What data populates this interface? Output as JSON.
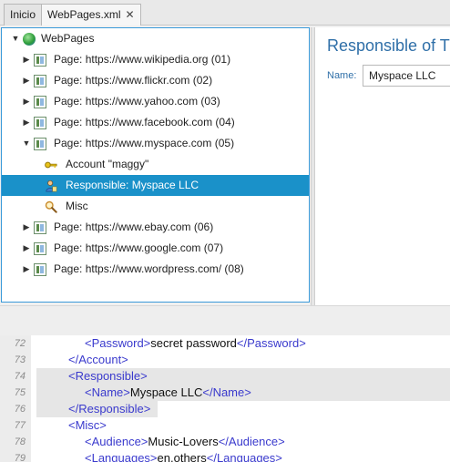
{
  "tabs": [
    {
      "label": "Inicio",
      "active": false
    },
    {
      "label": "WebPages.xml",
      "active": true,
      "close": "✕"
    }
  ],
  "tree": {
    "root": {
      "label": "WebPages",
      "icon": "globe-icon",
      "expanded": true
    },
    "items": [
      {
        "label": "Page: https://www.wikipedia.org (01)",
        "icon": "page-icon",
        "expanded": false
      },
      {
        "label": "Page: https://www.flickr.com (02)",
        "icon": "page-icon",
        "expanded": false
      },
      {
        "label": "Page: https://www.yahoo.com (03)",
        "icon": "page-icon",
        "expanded": false
      },
      {
        "label": "Page: https://www.facebook.com (04)",
        "icon": "page-icon",
        "expanded": false
      },
      {
        "label": "Page: https://www.myspace.com (05)",
        "icon": "page-icon",
        "expanded": true
      },
      {
        "label": "Account \"maggy\"",
        "icon": "key-icon",
        "child": true
      },
      {
        "label": "Responsible: Myspace LLC",
        "icon": "person-icon",
        "child": true,
        "selected": true
      },
      {
        "label": "Misc",
        "icon": "magnifier-icon",
        "child": true
      },
      {
        "label": "Page: https://www.ebay.com (06)",
        "icon": "page-icon",
        "expanded": false
      },
      {
        "label": "Page: https://www.google.com (07)",
        "icon": "page-icon",
        "expanded": false
      },
      {
        "label": "Page: https://www.wordpress.com/ (08)",
        "icon": "page-icon",
        "expanded": false
      }
    ]
  },
  "details": {
    "title": "Responsible of The",
    "name_label": "Name:",
    "name_value": "Myspace LLC"
  },
  "editor": {
    "lines": [
      {
        "no": "72",
        "indent": 2,
        "open": "<Password>",
        "text": "secret password",
        "close": "</Password>"
      },
      {
        "no": "73",
        "indent": 1,
        "open": "",
        "text": "",
        "close": "</Account>"
      },
      {
        "no": "74",
        "indent": 1,
        "open": "<Responsible>",
        "text": "",
        "close": ""
      },
      {
        "no": "75",
        "indent": 2,
        "open": "<Name>",
        "text": "Myspace LLC",
        "close": "</Name>"
      },
      {
        "no": "76",
        "indent": 1,
        "open": "",
        "text": "",
        "close": "</Responsible>"
      },
      {
        "no": "77",
        "indent": 1,
        "open": "<Misc>",
        "text": "",
        "close": ""
      },
      {
        "no": "78",
        "indent": 2,
        "open": "<Audience>",
        "text": "Music-Lovers",
        "close": "</Audience>"
      },
      {
        "no": "79",
        "indent": 2,
        "open": "<Languages>",
        "text": "en,others",
        "close": "</Languages>"
      }
    ]
  },
  "colors": {
    "selection": "#1a91c9",
    "panel_border": "#3a9ad9",
    "title_blue": "#2f6fa8",
    "xml_tag": "#3a3acd",
    "line_highlight": "#e6e6e6"
  }
}
